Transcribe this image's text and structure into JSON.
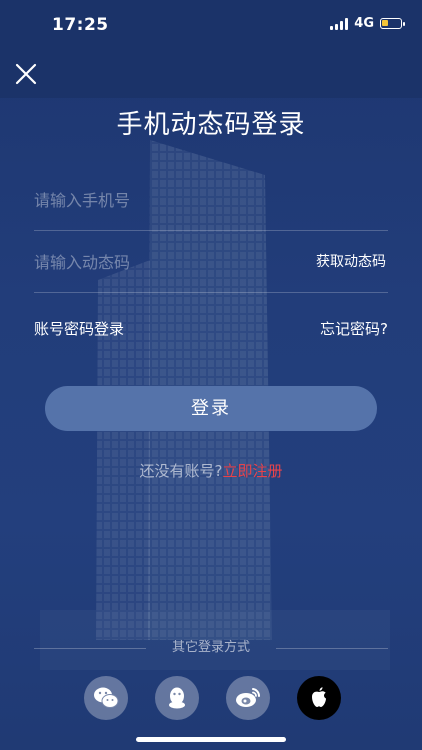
{
  "status_bar": {
    "time": "17:25",
    "network": "4G"
  },
  "page": {
    "title": "手机动态码登录"
  },
  "form": {
    "phone_placeholder": "请输入手机号",
    "phone_value": "",
    "code_placeholder": "请输入动态码",
    "code_value": "",
    "get_code_label": "获取动态码"
  },
  "links": {
    "password_login": "账号密码登录",
    "forgot_password": "忘记密码?"
  },
  "login_button": "登录",
  "register": {
    "prompt": "还没有账号?",
    "link": "立即注册"
  },
  "other_login": {
    "label": "其它登录方式",
    "methods": [
      "wechat-icon",
      "qq-icon",
      "weibo-icon",
      "apple-icon"
    ]
  },
  "colors": {
    "background": "#203a74",
    "button": "#5573aa",
    "register_link": "#e8434a",
    "battery": "#f2c438"
  }
}
